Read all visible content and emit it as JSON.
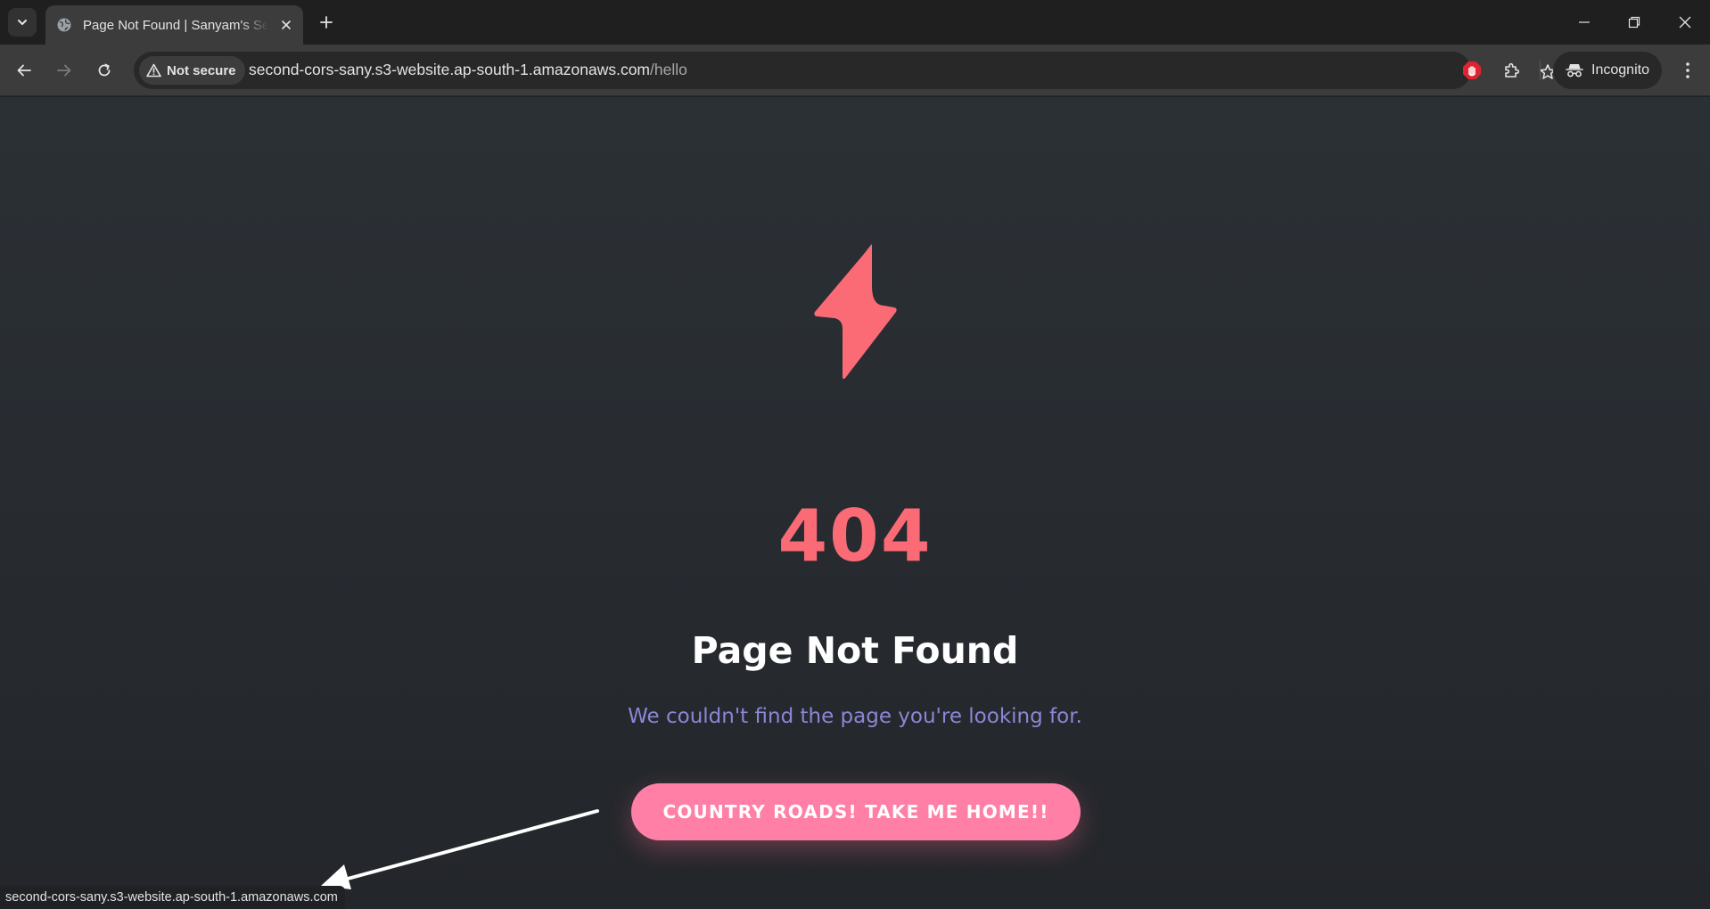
{
  "browser": {
    "tab": {
      "title": "Page Not Found | Sanyam's Second"
    },
    "address_bar": {
      "security_label": "Not secure",
      "url_host": "second-cors-sany.s3-website.ap-south-1.amazonaws.com",
      "url_path": "/hello"
    },
    "profile": {
      "label": "Incognito"
    },
    "status_bar": {
      "url": "second-cors-sany.s3-website.ap-south-1.amazonaws.com"
    }
  },
  "page": {
    "error_code": "404",
    "title": "Page Not Found",
    "message": "We couldn't find the page you're looking for.",
    "home_button_label": "COUNTRY ROADS! TAKE ME HOME!!",
    "icon": "lightning-bolt-icon"
  },
  "colors": {
    "accent": "#fa6b76",
    "button": "#ff7fa6",
    "message": "#8b86d6",
    "background": "#272b30"
  }
}
